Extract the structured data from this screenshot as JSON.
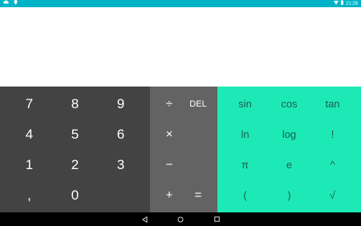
{
  "status_bar": {
    "time": "21:29",
    "left_icons": [
      "cloud-icon",
      "location-icon"
    ],
    "right_icons": [
      "wifi-icon",
      "battery-icon"
    ]
  },
  "display": {
    "formula": "",
    "result": ""
  },
  "numpad": {
    "keys": [
      "7",
      "8",
      "9",
      "4",
      "5",
      "6",
      "1",
      "2",
      "3",
      ",",
      "0"
    ]
  },
  "operators": {
    "divide": "÷",
    "delete": "DEL",
    "multiply": "×",
    "minus": "−",
    "plus": "+",
    "equals": "="
  },
  "advanced": {
    "keys": [
      "sin",
      "cos",
      "tan",
      "ln",
      "log",
      "!",
      "π",
      "e",
      "^",
      "(",
      ")",
      "√"
    ]
  },
  "colors": {
    "status_bar": "#00b3c7",
    "numpad_bg": "#434343",
    "operator_bg": "#636363",
    "advanced_bg": "#1de9b6",
    "advanced_text": "#1f5c4d"
  },
  "nav_bar": {
    "icons": [
      "back-icon",
      "home-icon",
      "recents-icon"
    ]
  }
}
